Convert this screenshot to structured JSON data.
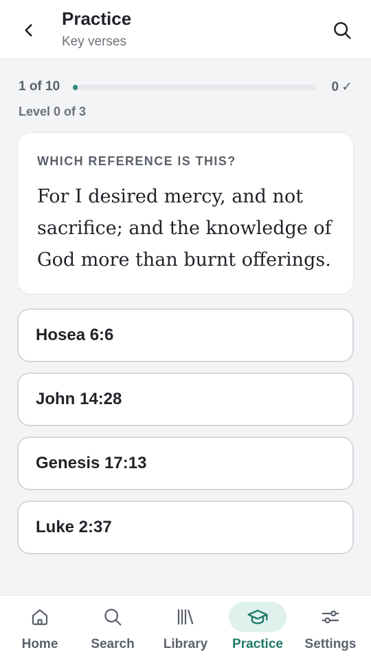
{
  "header": {
    "title": "Practice",
    "subtitle": "Key verses",
    "back_icon": "chevron-left-icon",
    "search_icon": "search-icon"
  },
  "progress": {
    "count_text": "1 of 10",
    "fraction": 0.1,
    "score": "0",
    "score_check": "✓",
    "level_text": "Level 0 of 3"
  },
  "question": {
    "label": "WHICH REFERENCE IS THIS?",
    "verse": "For I desired mercy, and not sacrifice; and the knowledge of God more than burnt offerings."
  },
  "options": [
    "Hosea 6:6",
    "John 14:28",
    "Genesis 17:13",
    "Luke 2:37"
  ],
  "nav": {
    "items": [
      {
        "label": "Home",
        "icon": "home-icon"
      },
      {
        "label": "Search",
        "icon": "search-icon"
      },
      {
        "label": "Library",
        "icon": "library-icon"
      },
      {
        "label": "Practice",
        "icon": "graduation-cap-icon",
        "active": true
      },
      {
        "label": "Settings",
        "icon": "sliders-icon"
      }
    ]
  },
  "colors": {
    "accent": "#1f7a6a",
    "accent_bg": "#dff1ed",
    "background": "#f3f4f6"
  }
}
